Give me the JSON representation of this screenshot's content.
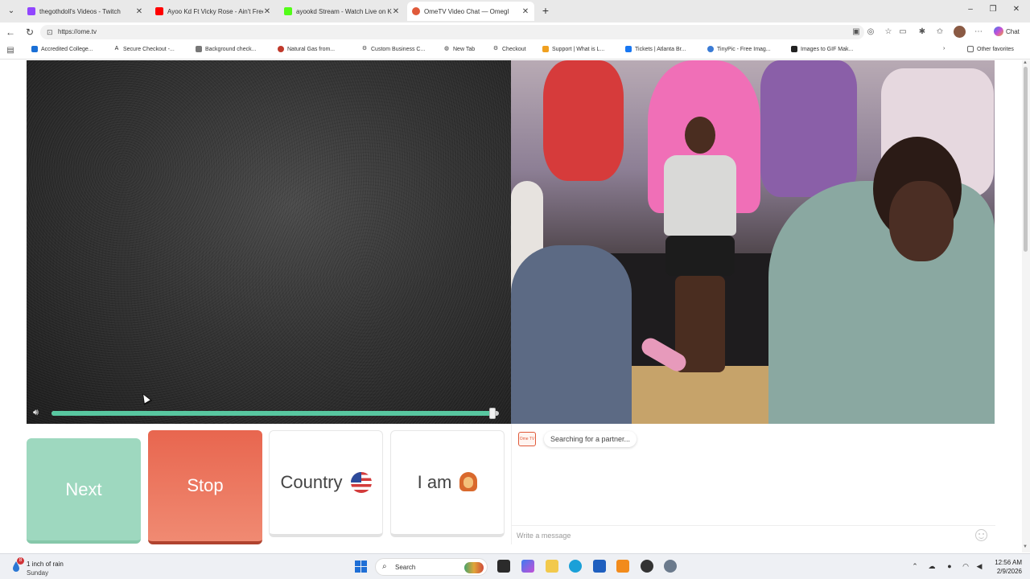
{
  "browser": {
    "tabs": [
      {
        "title": "thegothdoll's Videos - Twitch",
        "color": "#9146ff"
      },
      {
        "title": "Ayoo Kd Ft Vicky Rose - Ain't Free",
        "color": "#ff0000"
      },
      {
        "title": "ayookd Stream - Watch Live on Ki",
        "color": "#53fc18"
      },
      {
        "title": "OmeTV Video Chat — Omegl",
        "color": "#e05a3a"
      }
    ],
    "url": "https://ome.tv",
    "copilot_label": "Chat",
    "favorites": [
      {
        "label": "Accredited College..."
      },
      {
        "label": "Secure Checkout -..."
      },
      {
        "label": "Background check..."
      },
      {
        "label": "Natural Gas from..."
      },
      {
        "label": "Custom Business C..."
      },
      {
        "label": "New Tab"
      },
      {
        "label": "Checkout"
      },
      {
        "label": "Support | What is L..."
      },
      {
        "label": "Tickets | Atlanta Br..."
      },
      {
        "label": "TinyPic - Free Imag..."
      },
      {
        "label": "Images to GIF Mak..."
      }
    ],
    "other_favorites": "Other favorites"
  },
  "controls": {
    "next": "Next",
    "stop": "Stop",
    "country": "Country",
    "iam": "I am",
    "volume_level": 0.99
  },
  "chat": {
    "logo_text": "Ome TV",
    "status": "Searching for a partner...",
    "placeholder": "Write a message"
  },
  "taskbar": {
    "weather_badge": "8",
    "weather_line1": "1 inch of rain",
    "weather_line2": "Sunday",
    "search_label": "Search",
    "time": "12:56 AM",
    "date": "2/9/2026"
  },
  "colors": {
    "next": "#9ed8bf",
    "stop": "#e8664f",
    "volume": "#58c7a0"
  }
}
